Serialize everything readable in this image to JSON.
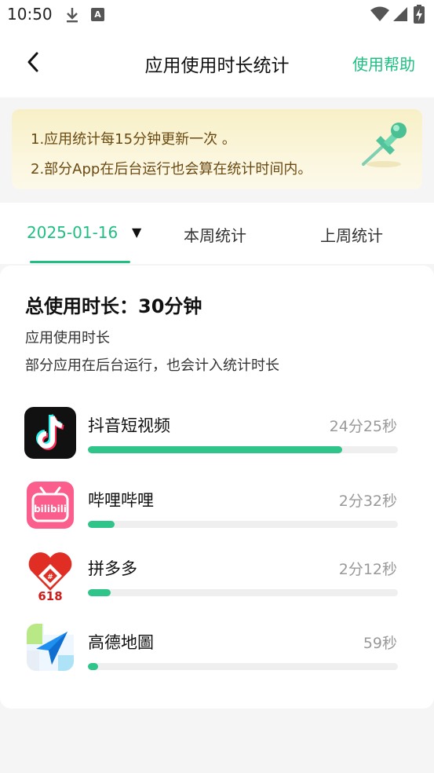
{
  "status": {
    "time": "10:50",
    "a_badge": "A"
  },
  "header": {
    "title": "应用使用时长统计",
    "help": "使用帮助"
  },
  "notice": {
    "line1": "1.应用统计每15分钟更新一次 。",
    "line2": "2.部分App在后台运行也会算在统计时间内。"
  },
  "tabs": {
    "date": "2025-01-16",
    "caret": "▼",
    "week": "本周统计",
    "last_week": "上周统计"
  },
  "summary": {
    "total": "总使用时长：30分钟",
    "subtitle": "应用使用时长",
    "note": "部分应用在后台运行，也会计入统计时长"
  },
  "apps": [
    {
      "name": "抖音短视频",
      "time": "24分25秒",
      "share": 0.82,
      "icon": "douyin-icon"
    },
    {
      "name": "哔哩哔哩",
      "time": "2分32秒",
      "share": 0.085,
      "icon": "bilibili-icon",
      "icon_text": "bilibili"
    },
    {
      "name": "拼多多",
      "time": "2分12秒",
      "share": 0.073,
      "icon": "pinduoduo-icon",
      "icon_text": "618"
    },
    {
      "name": "高德地圖",
      "time": "59秒",
      "share": 0.033,
      "icon": "amap-icon"
    }
  ],
  "colors": {
    "accent": "#1fbf83",
    "bar": "#2ec48a",
    "notice_text": "#6b4a12"
  }
}
